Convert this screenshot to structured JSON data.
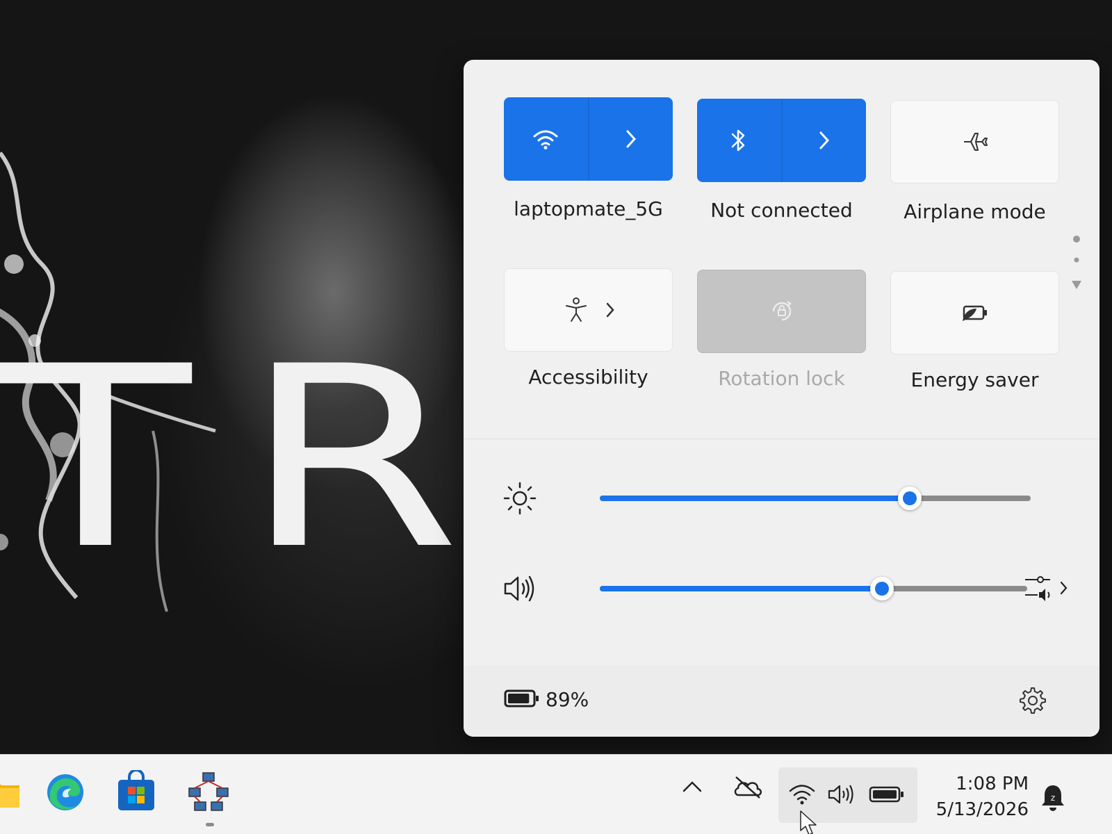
{
  "wallpaper": {
    "letters": "TR"
  },
  "quick_settings": {
    "tiles": [
      {
        "id": "wifi",
        "label": "laptopmate_5G",
        "state": "on",
        "icon": "wifi-icon"
      },
      {
        "id": "bluetooth",
        "label": "Not connected",
        "state": "on",
        "icon": "bluetooth-icon"
      },
      {
        "id": "airplane",
        "label": "Airplane mode",
        "state": "off",
        "icon": "airplane-icon"
      },
      {
        "id": "accessibility",
        "label": "Accessibility",
        "state": "off",
        "icon": "accessibility-icon"
      },
      {
        "id": "rotation",
        "label": "Rotation lock",
        "state": "disabled",
        "icon": "rotation-lock-icon"
      },
      {
        "id": "energy",
        "label": "Energy saver",
        "state": "off",
        "icon": "energy-saver-icon"
      }
    ],
    "brightness": {
      "value": 0.72,
      "icon": "brightness-icon"
    },
    "volume": {
      "value": 0.66,
      "icon": "speaker-icon"
    },
    "battery": {
      "percent_text": "89%",
      "level": 0.89
    },
    "accent_color": "#1a73e8"
  },
  "taskbar": {
    "apps": [
      "file-explorer-icon",
      "edge-icon",
      "store-icon",
      "network-app-icon"
    ],
    "tray": [
      "show-hidden-icons-chevron",
      "onedrive-offline-icon",
      "wifi-icon",
      "speaker-icon",
      "battery-icon"
    ],
    "time": "1:08 PM",
    "date": "5/13/2026"
  }
}
